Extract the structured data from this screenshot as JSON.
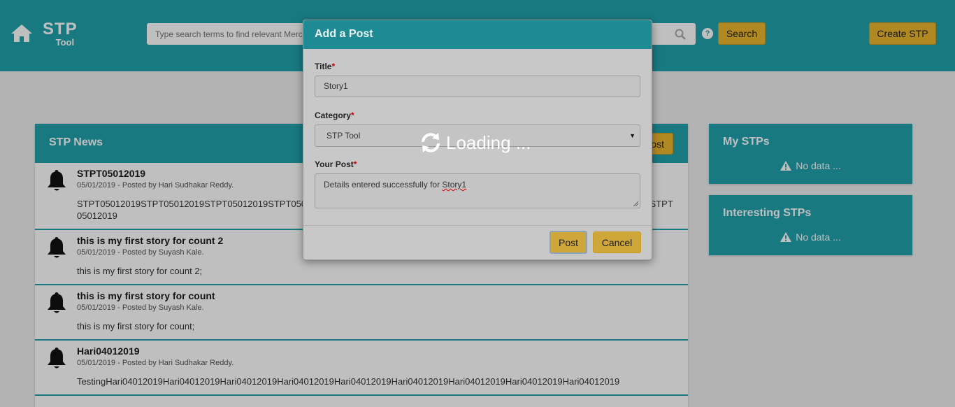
{
  "header": {
    "logo_big": "STP",
    "logo_small": "Tool",
    "search_placeholder": "Type search terms to find relevant Merchandise",
    "search_button": "Search",
    "create_button": "Create STP",
    "help_glyph": "?"
  },
  "news": {
    "title": "STP News",
    "add_post_label": "Add Post",
    "items": [
      {
        "title": "STPT05012019",
        "meta": "05/01/2019 - Posted by Hari Sudhakar Reddy.",
        "body": "STPT05012019STPT05012019STPT05012019STPT05012019STPT05012019STPT05012019STPT05012019STPT05012019STPT05012019STPT05012019"
      },
      {
        "title": "this is my first story for count 2",
        "meta": "05/01/2019 - Posted by Suyash Kale.",
        "body": "this is my first story for count 2;"
      },
      {
        "title": "this is my first story for count",
        "meta": "05/01/2019 - Posted by Suyash Kale.",
        "body": "this is my first story for count;"
      },
      {
        "title": "Hari04012019",
        "meta": "05/01/2019 - Posted by Hari Sudhakar Reddy.",
        "body": "TestingHari04012019Hari04012019Hari04012019Hari04012019Hari04012019Hari04012019Hari04012019Hari04012019Hari04012019"
      }
    ]
  },
  "my_stps": {
    "title": "My STPs",
    "empty": "No data ..."
  },
  "interesting_stps": {
    "title": "Interesting STPs",
    "empty": "No data ..."
  },
  "modal": {
    "title": "Add a Post",
    "title_label": "Title",
    "title_value": "Story1",
    "category_label": "Category",
    "category_value": "STP Tool",
    "post_label": "Your Post",
    "post_value_prefix": "Details entered successfully for ",
    "post_value_misspelled": "Story1",
    "post_button": "Post",
    "cancel_button": "Cancel",
    "required_mark": "*"
  },
  "loading": {
    "text": "Loading ..."
  },
  "icons": {
    "home": "home-icon",
    "search": "search-icon",
    "help": "help-icon",
    "bell": "bell-icon",
    "warning": "warning-icon",
    "refresh": "refresh-icon"
  },
  "colors": {
    "brand_teal": "#22a2ad",
    "button_yellow": "#ecb72e"
  }
}
